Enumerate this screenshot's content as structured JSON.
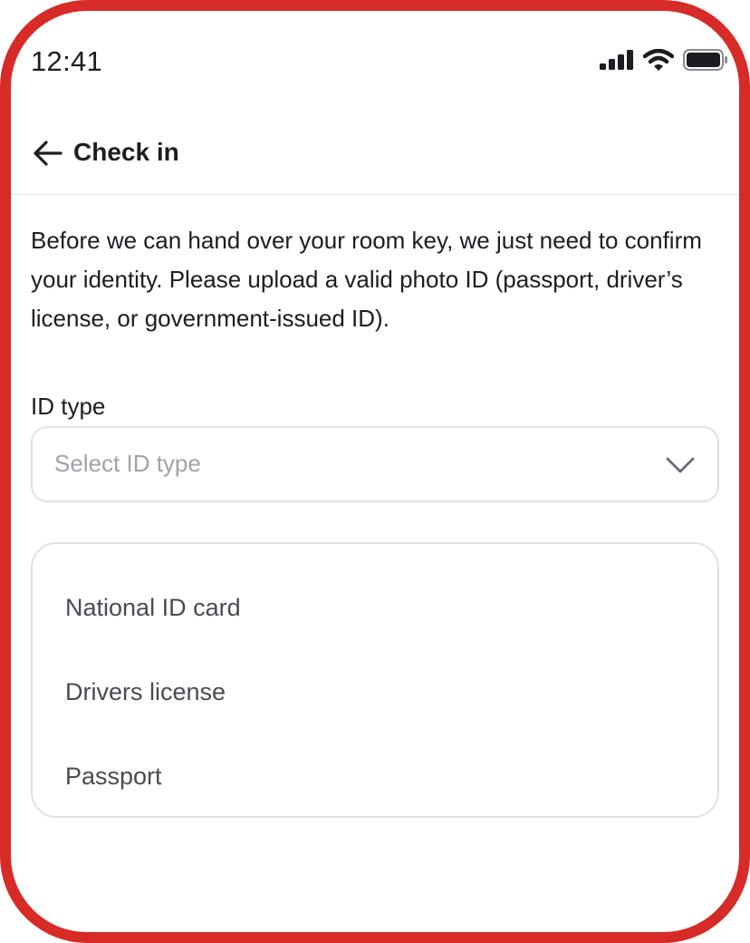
{
  "status_bar": {
    "time": "12:41",
    "icons": [
      "signal-icon",
      "wifi-icon",
      "battery-icon"
    ]
  },
  "header": {
    "back_icon": "arrow-left-icon",
    "title": "Check in"
  },
  "intro_text": "Before we can hand over your room key, we just need to confirm your identity. Please upload a valid photo ID (passport, driver’s license, or government-issued ID).",
  "id_type": {
    "label": "ID type",
    "placeholder": "Select ID type",
    "chevron_icon": "chevron-down-icon",
    "options": [
      "National ID card",
      "Drivers license",
      "Passport"
    ]
  },
  "colors": {
    "frame": "#d62b26",
    "text": "#1c1d22",
    "placeholder": "#a2a3a8",
    "option_text": "#4a4b52",
    "border": "#e2e2e5"
  }
}
